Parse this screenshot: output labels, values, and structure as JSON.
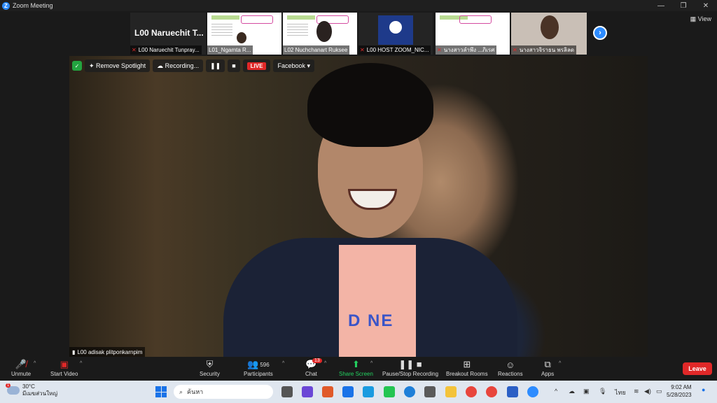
{
  "window": {
    "title": "Zoom Meeting",
    "controls": [
      "—",
      "❐",
      "✕"
    ]
  },
  "view_label": "View",
  "strip": {
    "namecard": {
      "big": "L00 Naruechit T...",
      "label": "L00 Naruechit Tunpray..."
    },
    "tiles": [
      {
        "label": "L01_Ngamta R..."
      },
      {
        "label": "L02 Nuchchanart Ruksee"
      },
      {
        "label": "L00 HOST ZOOM_NIC..."
      },
      {
        "label": "นางสาวลำพึง ...ภิเรศ"
      },
      {
        "label": "นางสาวจิราธน พรลิลด"
      }
    ]
  },
  "video_controls": {
    "remove_spotlight": "Remove Spotlight",
    "recording": "Recording...",
    "live": "LIVE",
    "facebook": "Facebook"
  },
  "shirt_text": "D  NE",
  "speaker_label": "L00 adisak plitponkarnpim",
  "toolbar": {
    "unmute": "Unmute",
    "start_video": "Start Video",
    "security": "Security",
    "participants": "Participants",
    "participants_count": "596",
    "chat": "Chat",
    "chat_badge": "13",
    "share_screen": "Share Screen",
    "pause_stop": "Pause/Stop Recording",
    "breakout": "Breakout Rooms",
    "reactions": "Reactions",
    "apps": "Apps",
    "leave": "Leave"
  },
  "taskbar": {
    "weather_temp": "30°C",
    "weather_desc": "มีเมฆส่วนใหญ่",
    "weather_badge": "1",
    "search": "ค้นหา",
    "lang": "ไทย",
    "time": "9:02 AM",
    "date": "5/28/2023"
  }
}
